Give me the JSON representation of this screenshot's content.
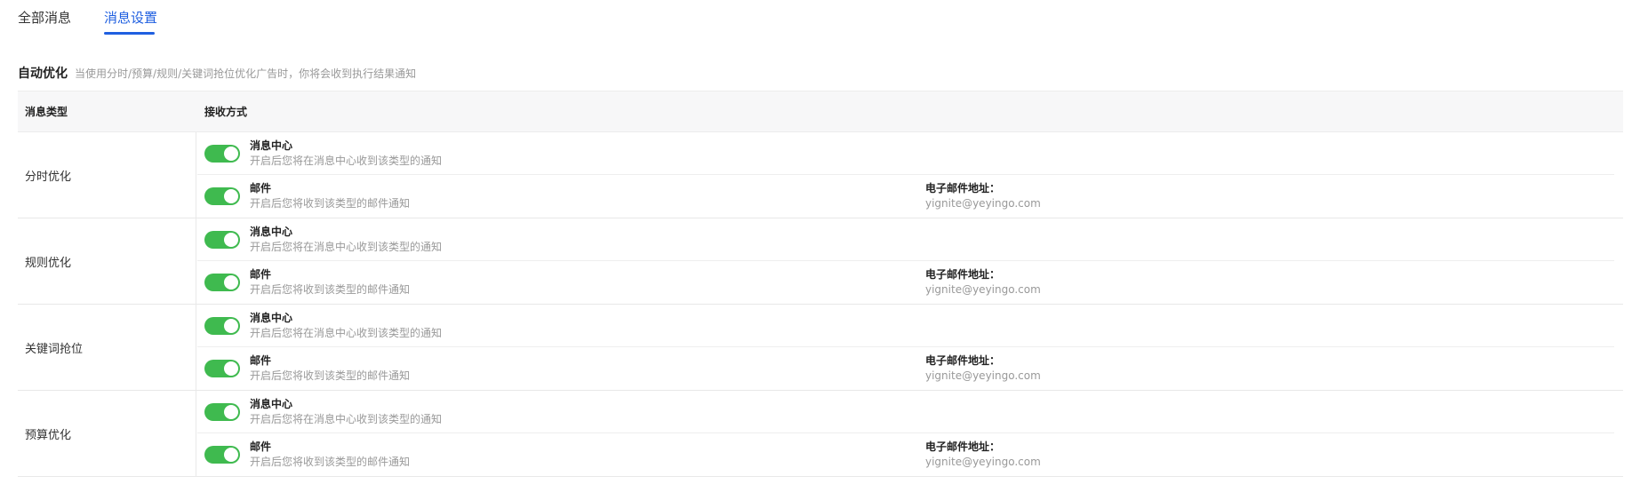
{
  "tabs": [
    {
      "label": "全部消息",
      "active": false
    },
    {
      "label": "消息设置",
      "active": true
    }
  ],
  "section": {
    "title": "自动优化",
    "description": "当使用分时/预算/规则/关键词抢位优化广告时，你将会收到执行结果通知"
  },
  "table": {
    "headers": [
      "消息类型",
      "接收方式"
    ],
    "rows": [
      {
        "type": "分时优化",
        "channels": [
          {
            "title": "消息中心",
            "desc": "开启后您将在消息中心收到该类型的通知",
            "enabled": true
          },
          {
            "title": "邮件",
            "desc": "开启后您将收到该类型的邮件通知",
            "enabled": true,
            "email_label": "电子邮件地址：",
            "email": "yignite@yeyingo.com"
          }
        ]
      },
      {
        "type": "规则优化",
        "channels": [
          {
            "title": "消息中心",
            "desc": "开启后您将在消息中心收到该类型的通知",
            "enabled": true
          },
          {
            "title": "邮件",
            "desc": "开启后您将收到该类型的邮件通知",
            "enabled": true,
            "email_label": "电子邮件地址：",
            "email": "yignite@yeyingo.com"
          }
        ]
      },
      {
        "type": "关键词抢位",
        "channels": [
          {
            "title": "消息中心",
            "desc": "开启后您将在消息中心收到该类型的通知",
            "enabled": true
          },
          {
            "title": "邮件",
            "desc": "开启后您将收到该类型的邮件通知",
            "enabled": true,
            "email_label": "电子邮件地址：",
            "email": "yignite@yeyingo.com"
          }
        ]
      },
      {
        "type": "预算优化",
        "channels": [
          {
            "title": "消息中心",
            "desc": "开启后您将在消息中心收到该类型的通知",
            "enabled": true
          },
          {
            "title": "邮件",
            "desc": "开启后您将收到该类型的邮件通知",
            "enabled": true,
            "email_label": "电子邮件地址：",
            "email": "yignite@yeyingo.com"
          }
        ]
      }
    ]
  },
  "colors": {
    "accent": "#1f5fe0",
    "switch_on": "#3fba4f"
  }
}
